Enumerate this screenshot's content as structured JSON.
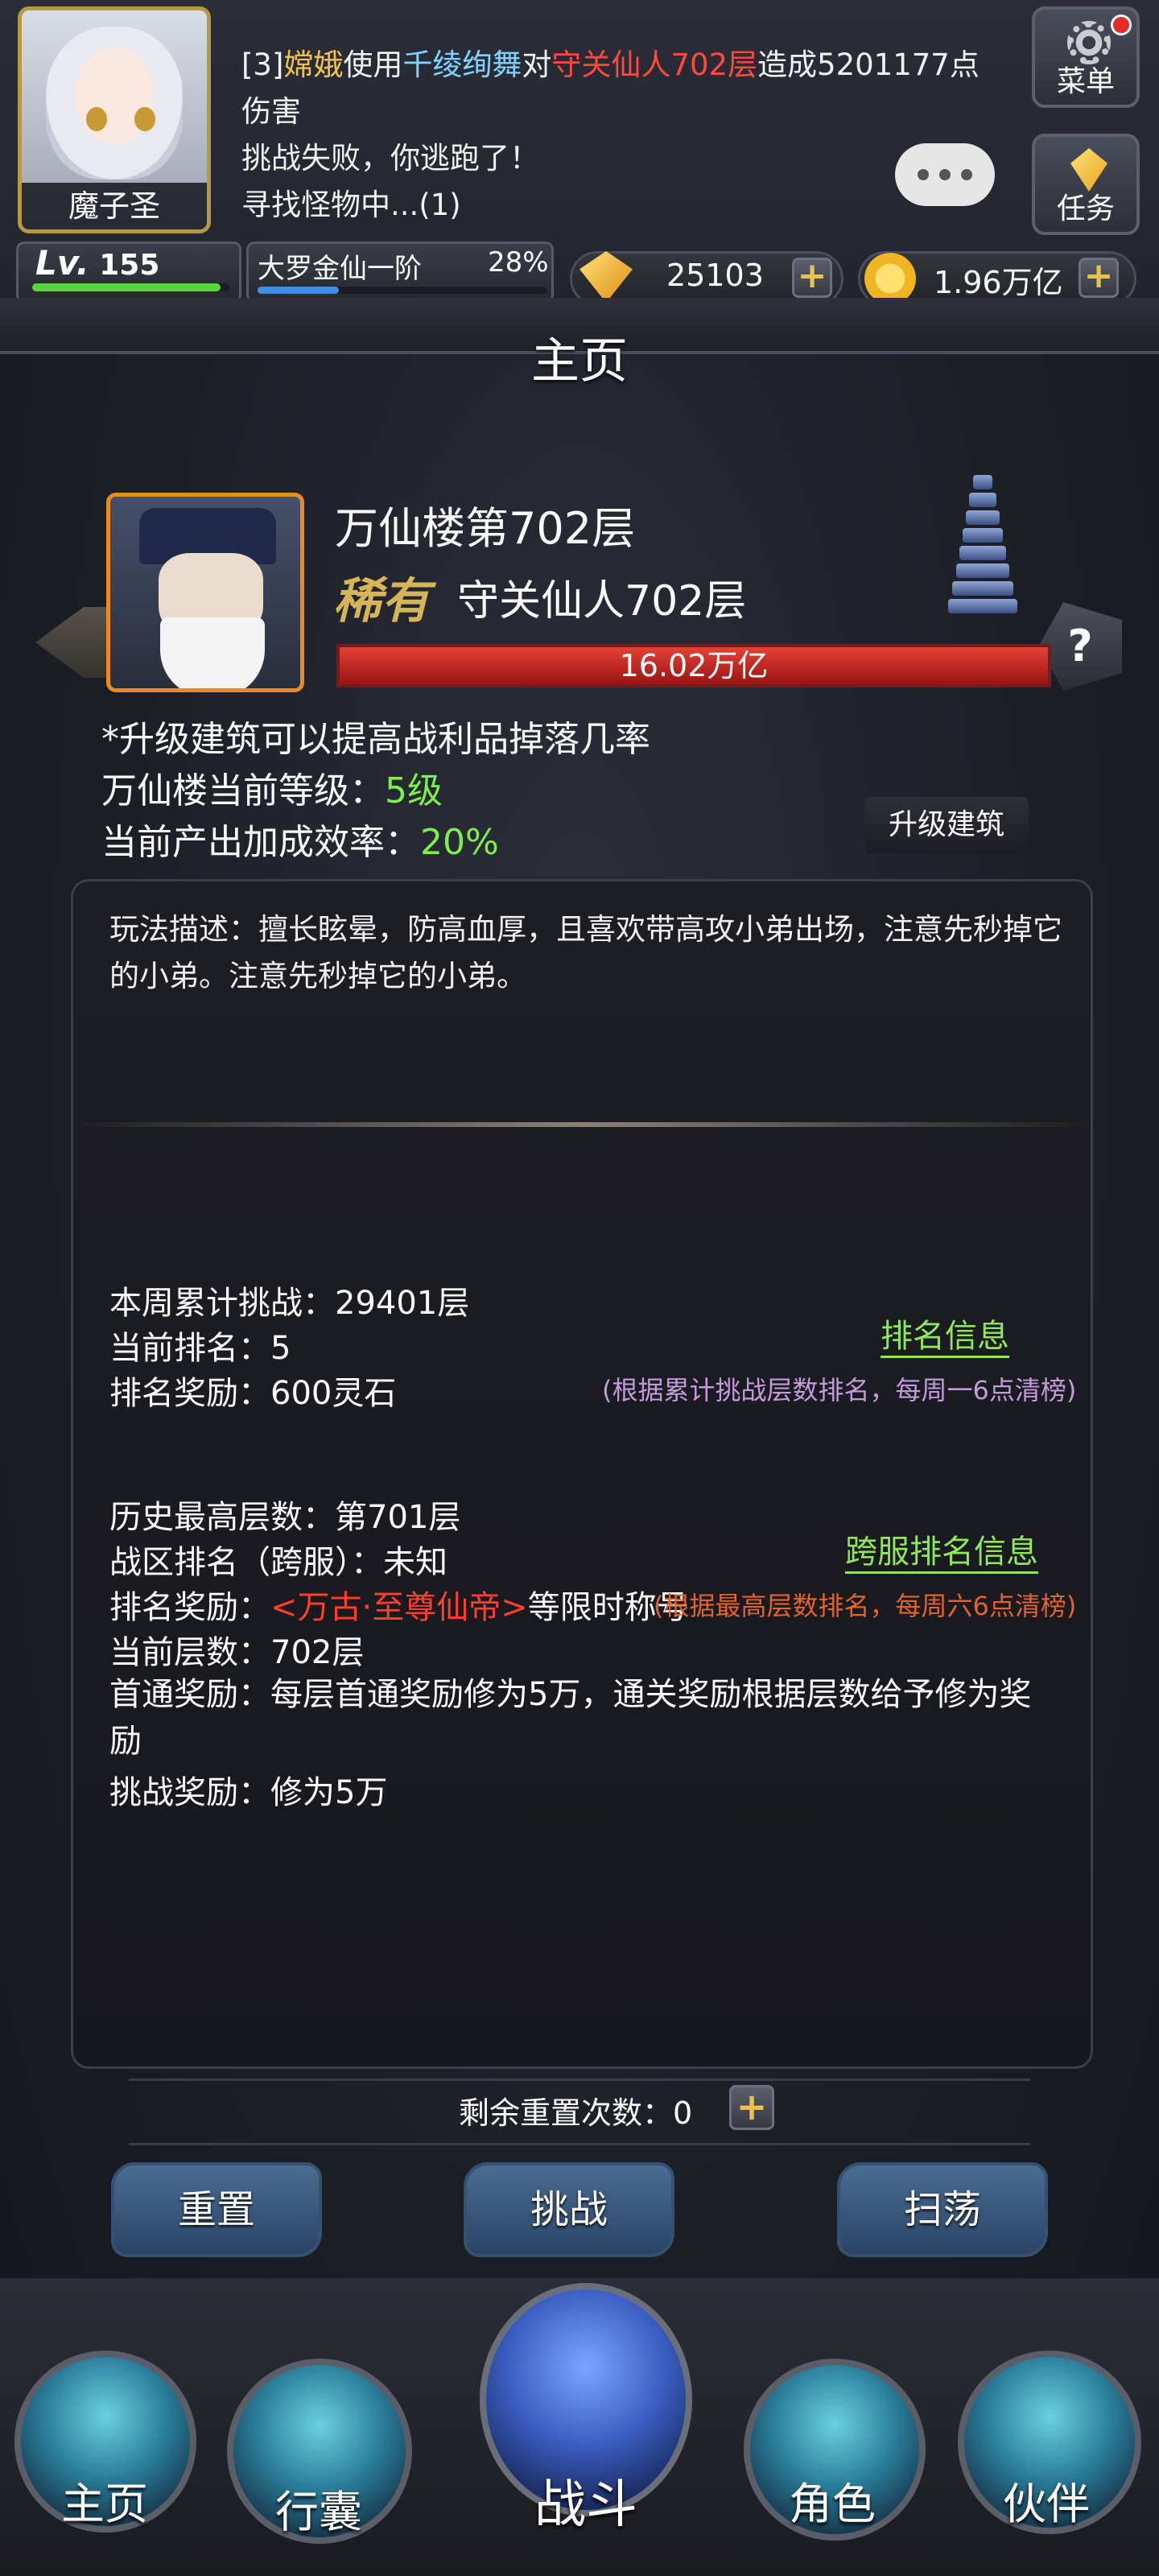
{
  "player": {
    "name": "魔子圣",
    "level_prefix": "Lv.",
    "level": "155",
    "level_progress": 0.95,
    "realm": "大罗金仙一阶",
    "realm_pct": "28%",
    "realm_progress": 0.28
  },
  "battle_log": {
    "line1_a": "[3]",
    "line1_actor": "嫦娥",
    "line1_b": "使用",
    "line1_skill": "千绫绚舞",
    "line1_c": "对",
    "line1_target": "守关仙人702层",
    "line1_d": "造成5201177点",
    "line2": "伤害",
    "line3": "挑战失败，你逃跑了！",
    "line4": "寻找怪物中...(1)"
  },
  "side_buttons": {
    "menu": "菜单",
    "quest": "任务"
  },
  "resources": {
    "gems": "25103",
    "gold": "1.96万亿",
    "plus": "+"
  },
  "page_title": "主页",
  "boss": {
    "floor_title": "万仙楼第702层",
    "rarity": "稀有",
    "name": "守关仙人702层",
    "hp": "16.02万亿",
    "hp_fraction": 1.0,
    "help": "?"
  },
  "building": {
    "tip": "*升级建筑可以提高战利品掉落几率",
    "level_label": "万仙楼当前等级：",
    "level_value": "5级",
    "bonus_label": "当前产出加成效率：",
    "bonus_value": "20%",
    "upgrade_button": "升级建筑"
  },
  "description": "玩法描述：擅长眩晕，防高血厚，且喜欢带高攻小弟出场，注意先秒掉它的小弟。注意先秒掉它的小弟。",
  "weekly": {
    "challenge": "本周累计挑战：29401层",
    "rank": "当前排名：5",
    "reward": "排名奖励：600灵石",
    "rank_link": "排名信息",
    "note": "(根据累计挑战层数排名，每周一6点清榜)"
  },
  "history": {
    "best": "历史最高层数：第701层",
    "cross_rank": "战区排名（跨服）：未知",
    "reward_prefix": "排名奖励：",
    "reward_title": "<万古·至尊仙帝>",
    "reward_suffix": "等限时称号",
    "cross_link": "跨服排名信息",
    "note": "(根据最高层数排名，每周六6点清榜)",
    "current_floor": "当前层数：702层",
    "first_clear": "首通奖励：每层首通奖励修为5万，通关奖励根据层数给予修为奖励",
    "challenge_reward": "挑战奖励：修为5万"
  },
  "reset": {
    "label": "剩余重置次数：0",
    "plus": "+"
  },
  "actions": {
    "reset": "重置",
    "challenge": "挑战",
    "sweep": "扫荡"
  },
  "nav": {
    "home": "主页",
    "bag": "行囊",
    "battle": "战斗",
    "role": "角色",
    "partner": "伙伴"
  }
}
